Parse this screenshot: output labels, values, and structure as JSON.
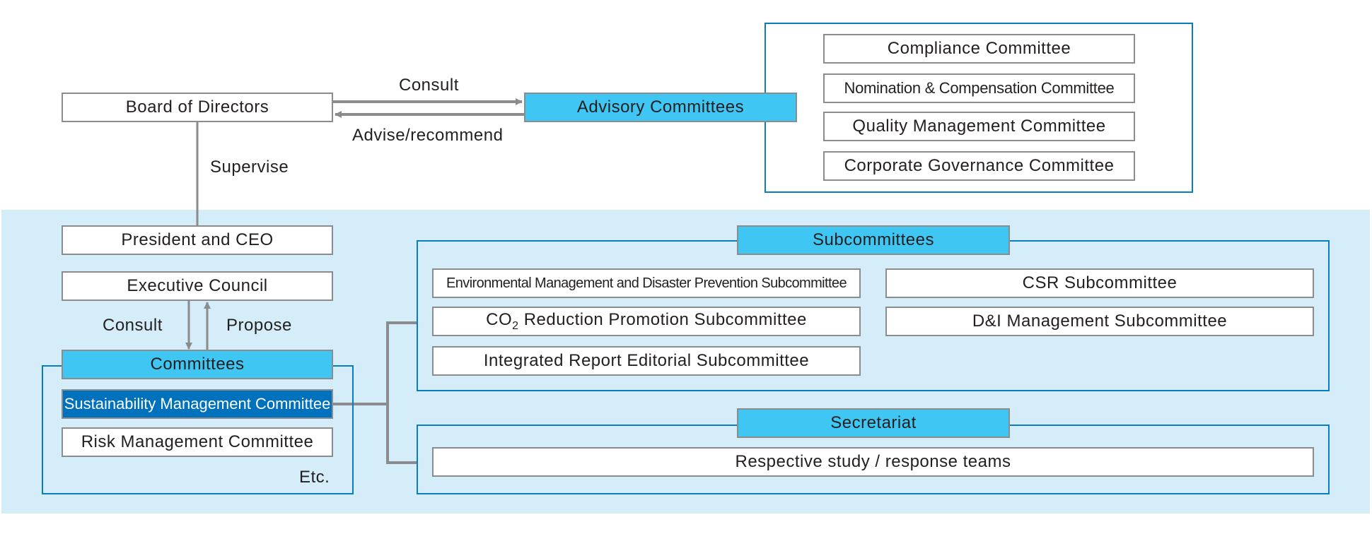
{
  "colors": {
    "header_fill": "#40c6f2",
    "highlight_fill": "#0071bc",
    "panel_border": "#0a7cc1",
    "background_band": "#d5edf9",
    "connector": "#8a8c8e"
  },
  "governance": {
    "board": "Board of Directors",
    "advisory_header": "Advisory Committees",
    "consult_label": "Consult",
    "advise_label": "Advise/recommend",
    "supervise_label": "Supervise",
    "advisory_committees": [
      "Compliance Committee",
      "Nomination & Compensation Committee",
      "Quality Management Committee",
      "Corporate Governance Committee"
    ]
  },
  "execution": {
    "president": "President and CEO",
    "executive_council": "Executive Council",
    "consult_label": "Consult",
    "propose_label": "Propose",
    "committees_header": "Committees",
    "committees": [
      "Sustainability Management Committee",
      "Risk Management Committee"
    ],
    "etc_label": "Etc."
  },
  "subcommittees": {
    "header": "Subcommittees",
    "items": [
      "Environmental Management and Disaster Prevention Subcommittee",
      "CO",
      "Reduction Promotion Subcommittee",
      "Integrated Report Editorial Subcommittee",
      "CSR Subcommittee",
      "D&I Management Subcommittee"
    ],
    "co2_subscript": "2"
  },
  "secretariat": {
    "header": "Secretariat",
    "teams": "Respective study / response teams"
  }
}
